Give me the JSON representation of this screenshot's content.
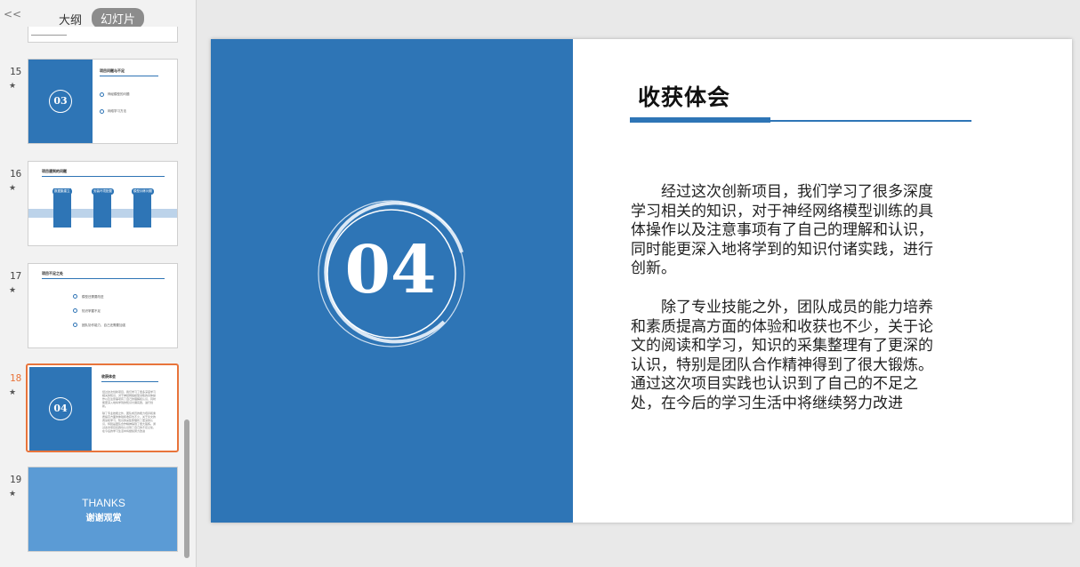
{
  "panel": {
    "collapse_label": "<<",
    "tabs": [
      {
        "label": "大纲"
      },
      {
        "label": "幻灯片"
      }
    ]
  },
  "thumbnails": [
    {
      "number": "15",
      "star": "★",
      "number_text": "03",
      "title": "项目问题与不足",
      "items": [
        "神经模型的问题",
        "网络学习方法"
      ]
    },
    {
      "number": "16",
      "star": "★",
      "title": "项目遇到的问题",
      "items": [
        "数据集建立",
        "安装环境配置",
        "模型训练问题"
      ]
    },
    {
      "number": "17",
      "star": "★",
      "title": "项目不足之处",
      "items": [
        "模型还需要改进",
        "知识掌握不足",
        "团队协作能力，自己还需要加强"
      ]
    },
    {
      "number": "18",
      "star": "★",
      "number_text": "04",
      "title": "收获体会",
      "paragraphs": [
        "经过这次创新项目，我们学习了很多深度学习相关的知识，对于神经网络模型训练的具体操作以及注意事项有了自己的理解和认识，同时能更深入地将学到的知识付诸实践，进行创新。",
        "除了专业技能之外，团队成员的能力培养和素质提高方面的体验和收获也不少，关于论文的阅读和学习，知识的采集整理有了更深的认识，特别是团队合作精神得到了很大锻炼。通过这次项目实践也认识到了自己的不足之处，在今后的学习生活中将继续努力改进"
      ]
    },
    {
      "number": "19",
      "star": "★",
      "thanks_en": "THANKS",
      "thanks_cn": "谢谢观赏"
    }
  ],
  "slide": {
    "number_text": "04",
    "title": "收获体会",
    "paragraphs": [
      "经过这次创新项目，我们学习了很多深度学习相关的知识，对于神经网络模型训练的具体操作以及注意事项有了自己的理解和认识，同时能更深入地将学到的知识付诸实践，进行创新。",
      "除了专业技能之外，团队成员的能力培养和素质提高方面的体验和收获也不少，关于论文的阅读和学习，知识的采集整理有了更深的认识，特别是团队合作精神得到了很大锻炼。通过这次项目实践也认识到了自己的不足之处，在今后的学习生活中将继续努力改进"
    ]
  },
  "colors": {
    "accent": "#2e75b6",
    "selected_border": "#e8743b",
    "thanks_bg": "#5b9bd5"
  }
}
